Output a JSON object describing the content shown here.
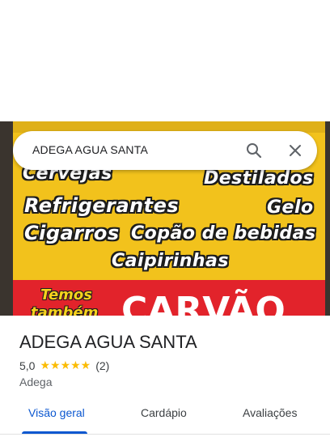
{
  "search": {
    "query": "ADEGA AGUA SANTA"
  },
  "photo": {
    "sign_lines": [
      "Cervejas",
      "Destilados",
      "Refrigerantes",
      "Gelo",
      "Cigarros",
      "Copão de bebidas",
      "Caipirinhas",
      "Temos",
      "também",
      "CARVÃO"
    ],
    "colors": {
      "sign_yellow": "#f2c21c",
      "sign_red": "#e2232b"
    }
  },
  "place": {
    "name": "ADEGA AGUA SANTA",
    "rating": "5,0",
    "stars": "★★★★★",
    "reviews": "(2)",
    "category": "Adega"
  },
  "tabs": [
    {
      "label": "Visão geral",
      "active": true
    },
    {
      "label": "Cardápio",
      "active": false
    },
    {
      "label": "Avaliações",
      "active": false
    }
  ],
  "icons": {
    "search": "search-icon",
    "close": "close-icon"
  },
  "colors": {
    "accent": "#0b57d0",
    "star": "#fbbc04"
  }
}
